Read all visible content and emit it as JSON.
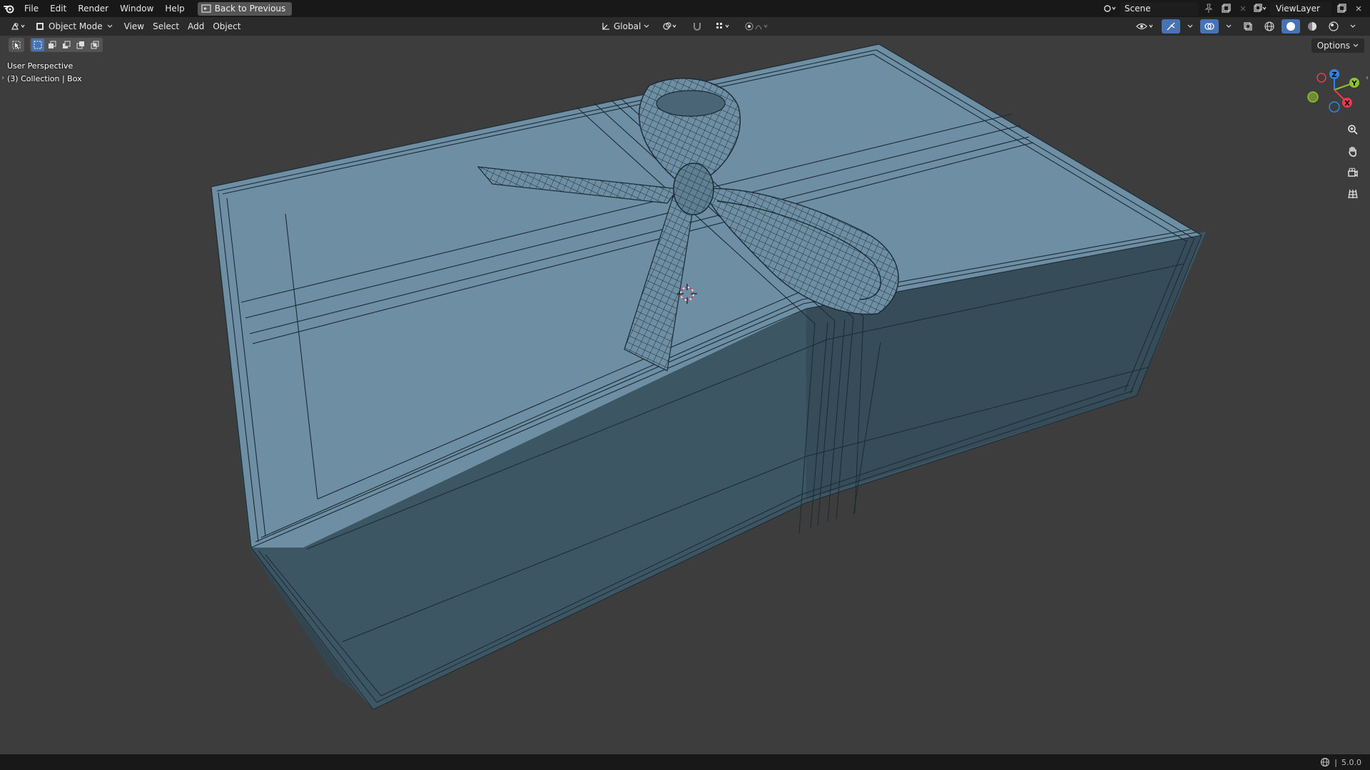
{
  "menu": {
    "items": [
      "File",
      "Edit",
      "Render",
      "Window",
      "Help"
    ],
    "back_button": "Back to Previous"
  },
  "topbar": {
    "scene_name": "Scene",
    "view_layer": "ViewLayer"
  },
  "header": {
    "mode": "Object Mode",
    "menus": [
      "View",
      "Select",
      "Add",
      "Object"
    ],
    "transform_orientation": "Global"
  },
  "viewport": {
    "options_label": "Options",
    "perspective_label": "User Perspective",
    "collection_label": "(3) Collection | Box"
  },
  "gizmo": {
    "z": "Z",
    "y": "Y",
    "x": "X",
    "colors": {
      "x": "#f0394f",
      "y": "#8ac42a",
      "z": "#2f84e3"
    }
  },
  "status": {
    "version": "5.0.0"
  },
  "colors": {
    "box_top": "#6d8ea3",
    "box_front": "#3f5866",
    "box_side": "#3a505c",
    "wire": "#1b2a33",
    "selection": "#4772b3"
  }
}
